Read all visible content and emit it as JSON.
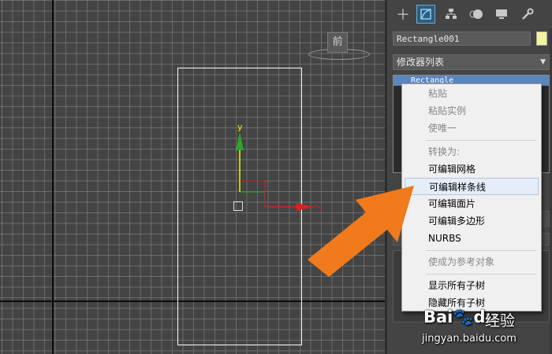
{
  "viewport": {
    "view_label": "前",
    "gizmo_y_label": "y"
  },
  "command_panel": {
    "tabs": [
      "create",
      "modify",
      "hierarchy",
      "motion",
      "display",
      "utilities"
    ],
    "active_tab": "modify",
    "object_name": "Rectangle001",
    "object_color": "#f3f3a0",
    "modifier_list_label": "修改器列表",
    "stack_item": "Rectangle"
  },
  "context_menu": {
    "items": [
      {
        "label": "粘贴",
        "enabled": false
      },
      {
        "label": "粘贴实例",
        "enabled": false
      },
      {
        "label": "使唯一",
        "enabled": false
      },
      {
        "label": "转换为:",
        "enabled": false
      },
      {
        "label": "可编辑网格",
        "enabled": true
      },
      {
        "label": "可编辑样条线",
        "enabled": true,
        "highlighted": true
      },
      {
        "label": "可编辑面片",
        "enabled": true
      },
      {
        "label": "可编辑多边形",
        "enabled": true
      },
      {
        "label": "NURBS",
        "enabled": true
      },
      {
        "label": "使成为参考对象",
        "enabled": false
      },
      {
        "label": "显示所有子树",
        "enabled": true
      },
      {
        "label": "隐藏所有子树",
        "enabled": true
      }
    ]
  },
  "annotation": {
    "arrow_color": "#f07a1c"
  },
  "watermark": {
    "logo": "Baidu",
    "label": "经验",
    "url": "jingyan.baidu.com"
  }
}
